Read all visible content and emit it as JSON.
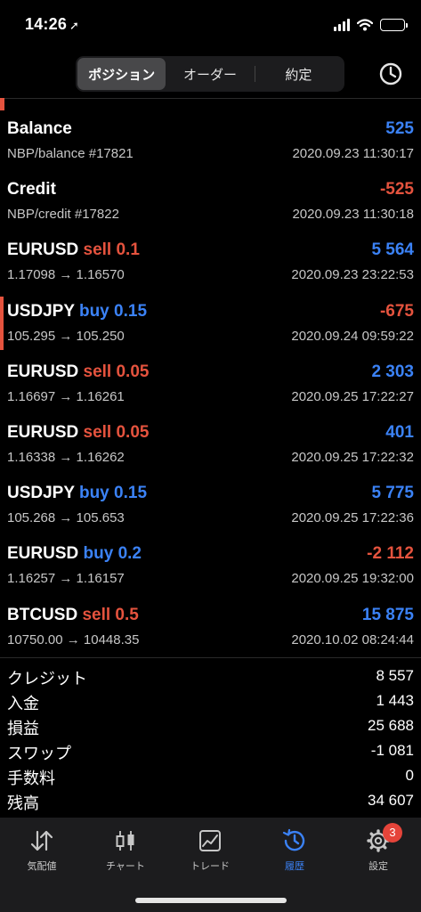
{
  "status_bar": {
    "time": "14:26",
    "location_arrow": "➚"
  },
  "segments": {
    "positions": "ポジション",
    "orders": "オーダー",
    "deals": "約定"
  },
  "history_icon": "clock-history-icon",
  "rows": [
    {
      "symbol": "Balance",
      "side": "",
      "volume": "",
      "detail": "NBP/balance #17821",
      "amount": "525",
      "amount_sign": "pos",
      "time": "2020.09.23 11:30:17"
    },
    {
      "symbol": "Credit",
      "side": "",
      "volume": "",
      "detail": "NBP/credit #17822",
      "amount": "-525",
      "amount_sign": "neg",
      "time": "2020.09.23 11:30:18"
    },
    {
      "symbol": "EURUSD",
      "side": "sell 0.1",
      "side_type": "neg",
      "detail": "1.17098 → 1.16570",
      "amount": "5 564",
      "amount_sign": "pos",
      "time": "2020.09.23 23:22:53"
    },
    {
      "symbol": "USDJPY",
      "side": "buy 0.15",
      "side_type": "pos",
      "detail": "105.295 → 105.250",
      "amount": "-675",
      "amount_sign": "neg",
      "time": "2020.09.24 09:59:22",
      "active": true
    },
    {
      "symbol": "EURUSD",
      "side": "sell 0.05",
      "side_type": "neg",
      "detail": "1.16697 → 1.16261",
      "amount": "2 303",
      "amount_sign": "pos",
      "time": "2020.09.25 17:22:27"
    },
    {
      "symbol": "EURUSD",
      "side": "sell 0.05",
      "side_type": "neg",
      "detail": "1.16338 → 1.16262",
      "amount": "401",
      "amount_sign": "pos",
      "time": "2020.09.25 17:22:32"
    },
    {
      "symbol": "USDJPY",
      "side": "buy 0.15",
      "side_type": "pos",
      "detail": "105.268 → 105.653",
      "amount": "5 775",
      "amount_sign": "pos",
      "time": "2020.09.25 17:22:36"
    },
    {
      "symbol": "EURUSD",
      "side": "buy 0.2",
      "side_type": "pos",
      "detail": "1.16257 → 1.16157",
      "amount": "-2 112",
      "amount_sign": "neg",
      "time": "2020.09.25 19:32:00"
    },
    {
      "symbol": "BTCUSD",
      "side": "sell 0.5",
      "side_type": "neg",
      "detail": "10750.00 → 10448.35",
      "amount": "15 875",
      "amount_sign": "pos",
      "time": "2020.10.02 08:24:44"
    }
  ],
  "summary": [
    {
      "label": "クレジット",
      "value": "8 557"
    },
    {
      "label": "入金",
      "value": "1 443"
    },
    {
      "label": "損益",
      "value": "25 688"
    },
    {
      "label": "スワップ",
      "value": "-1 081"
    },
    {
      "label": "手数料",
      "value": "0"
    },
    {
      "label": "残高",
      "value": "34 607"
    }
  ],
  "tabbar": {
    "quotes": "気配値",
    "chart": "チャート",
    "trade": "トレード",
    "history": "履歴",
    "settings": "設定",
    "settings_badge": "3"
  },
  "colors": {
    "positive": "#3b82f6",
    "negative": "#e5533e",
    "active_tab": "#3b82f6"
  }
}
